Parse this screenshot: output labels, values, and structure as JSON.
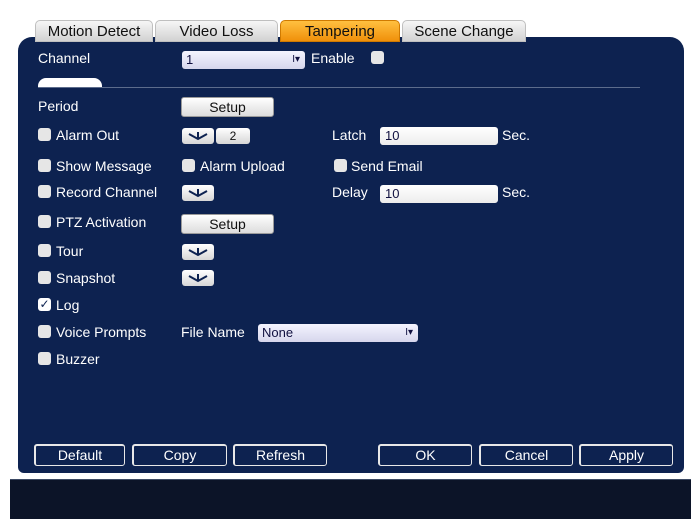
{
  "tabs": [
    {
      "label": "Motion Detect",
      "active": false
    },
    {
      "label": "Video Loss",
      "active": false
    },
    {
      "label": "Tampering",
      "active": true
    },
    {
      "label": "Scene Change",
      "active": false
    }
  ],
  "channel": {
    "label": "Channel",
    "value": "1"
  },
  "enable": {
    "label": "Enable",
    "checked": false
  },
  "period": {
    "label": "Period",
    "button": "Setup"
  },
  "alarm_out": {
    "label": "Alarm Out",
    "checked": false,
    "value": "2"
  },
  "latch": {
    "label": "Latch",
    "value": "10",
    "unit": "Sec."
  },
  "show_message": {
    "label": "Show Message",
    "checked": false
  },
  "alarm_upload": {
    "label": "Alarm Upload",
    "checked": false
  },
  "send_email": {
    "label": "Send Email",
    "checked": false
  },
  "record_channel": {
    "label": "Record Channel",
    "checked": false
  },
  "delay": {
    "label": "Delay",
    "value": "10",
    "unit": "Sec."
  },
  "ptz_activation": {
    "label": "PTZ Activation",
    "checked": false,
    "button": "Setup"
  },
  "tour": {
    "label": "Tour",
    "checked": false
  },
  "snapshot": {
    "label": "Snapshot",
    "checked": false
  },
  "log": {
    "label": "Log",
    "checked": true,
    "check_mark": "✓"
  },
  "voice_prompts": {
    "label": "Voice Prompts",
    "checked": false,
    "file_label": "File Name",
    "file_value": "None"
  },
  "buzzer": {
    "label": "Buzzer",
    "checked": false
  },
  "footer": {
    "default": "Default",
    "copy": "Copy",
    "refresh": "Refresh",
    "ok": "OK",
    "cancel": "Cancel",
    "apply": "Apply"
  },
  "colors": {
    "panel": "#0d2250",
    "active_tab": "#f4a020",
    "text": "#ffffff"
  }
}
